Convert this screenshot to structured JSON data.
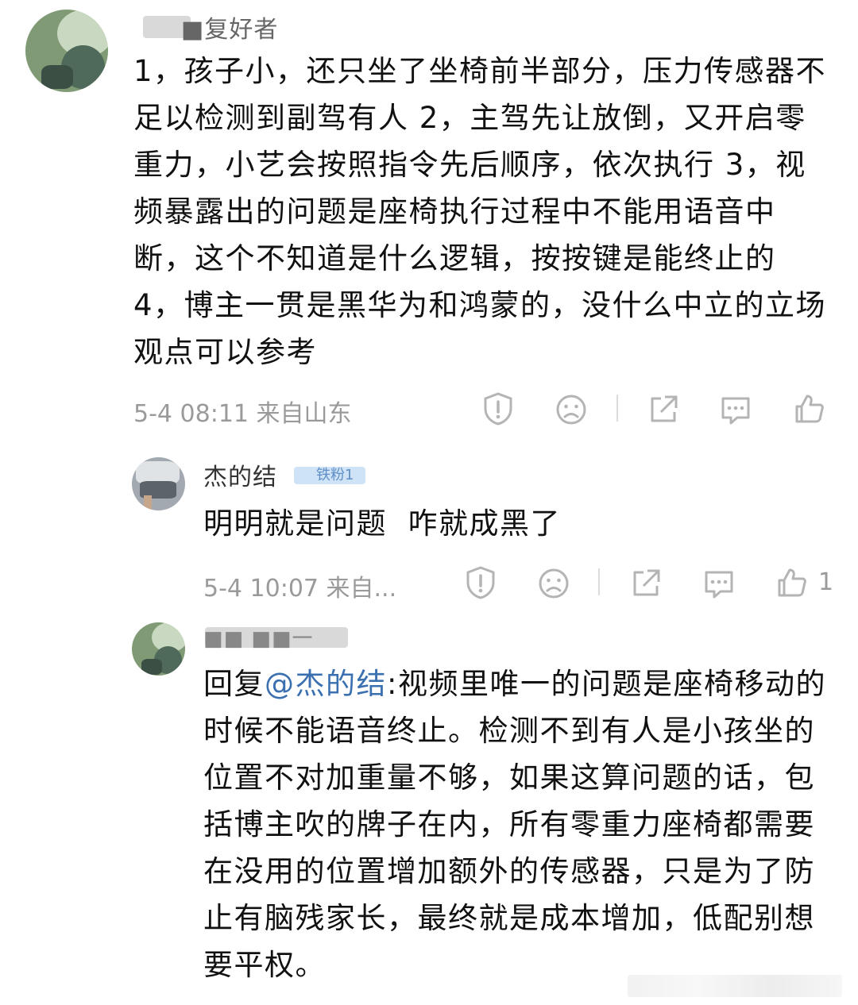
{
  "comments": [
    {
      "username": "■复好者",
      "text": "1，孩子小，还只坐了坐椅前半部分，压力传感器不足以检测到副驾有人 2，主驾先让放倒，又开启零重力，小艺会按照指令先后顺序，依次执行 3，视频暴露出的问题是座椅执行过程中不能用语音中断，这个不知道是什么逻辑，按按键是能终止的 4，博主一贯是黑华为和鸿蒙的，没什么中立的立场观点可以参考",
      "meta": "5-4 08:11 来自山东"
    },
    {
      "username": "杰的结",
      "badge": "铁粉1",
      "text": "明明就是问题  咋就成黑了",
      "meta": "5-4 10:07 来自...",
      "like_count": "1"
    },
    {
      "username": "■■ ■■一",
      "reply_prefix": "回复",
      "reply_mention": "@杰的结",
      "text": ":视频里唯一的问题是座椅移动的时候不能语音终止。检测不到有人是小孩坐的位置不对加重量不够，如果这算问题的话，包括博主吹的牌子在内，所有零重力座椅都需要在没用的位置增加额外的传感器，只是为了防止有脑残家长，最终就是成本增加，低配别想要平权。"
    }
  ],
  "icons": [
    "report-icon",
    "dislike-icon",
    "share-icon",
    "comment-icon",
    "like-icon"
  ],
  "colors": {
    "text": "#111111",
    "meta": "#9a9a9a",
    "icon": "#b4b4b4",
    "mention": "#3a6fb0"
  }
}
